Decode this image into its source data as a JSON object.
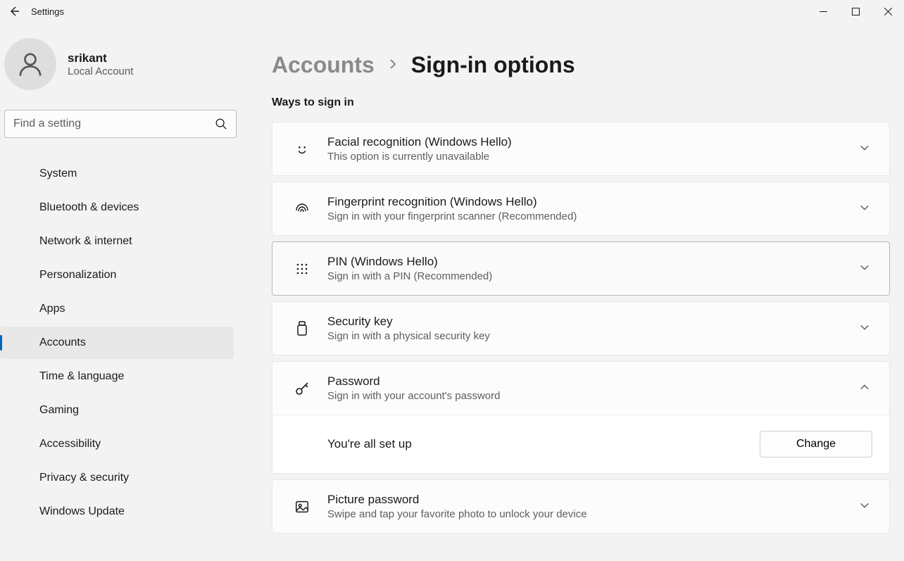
{
  "app": {
    "title": "Settings"
  },
  "profile": {
    "name": "srikant",
    "sub": "Local Account"
  },
  "search": {
    "placeholder": "Find a setting"
  },
  "nav": {
    "items": [
      {
        "label": "System"
      },
      {
        "label": "Bluetooth & devices"
      },
      {
        "label": "Network & internet"
      },
      {
        "label": "Personalization"
      },
      {
        "label": "Apps"
      },
      {
        "label": "Accounts"
      },
      {
        "label": "Time & language"
      },
      {
        "label": "Gaming"
      },
      {
        "label": "Accessibility"
      },
      {
        "label": "Privacy & security"
      },
      {
        "label": "Windows Update"
      }
    ],
    "active_index": 5
  },
  "breadcrumb": {
    "parent": "Accounts",
    "current": "Sign-in options"
  },
  "section": {
    "label": "Ways to sign in"
  },
  "options": {
    "facial": {
      "title": "Facial recognition (Windows Hello)",
      "sub": "This option is currently unavailable"
    },
    "fingerprint": {
      "title": "Fingerprint recognition (Windows Hello)",
      "sub": "Sign in with your fingerprint scanner (Recommended)"
    },
    "pin": {
      "title": "PIN (Windows Hello)",
      "sub": "Sign in with a PIN (Recommended)"
    },
    "securitykey": {
      "title": "Security key",
      "sub": "Sign in with a physical security key"
    },
    "password": {
      "title": "Password",
      "sub": "Sign in with your account's password",
      "body_text": "You're all set up",
      "change_label": "Change"
    },
    "picture": {
      "title": "Picture password",
      "sub": "Swipe and tap your favorite photo to unlock your device"
    }
  }
}
